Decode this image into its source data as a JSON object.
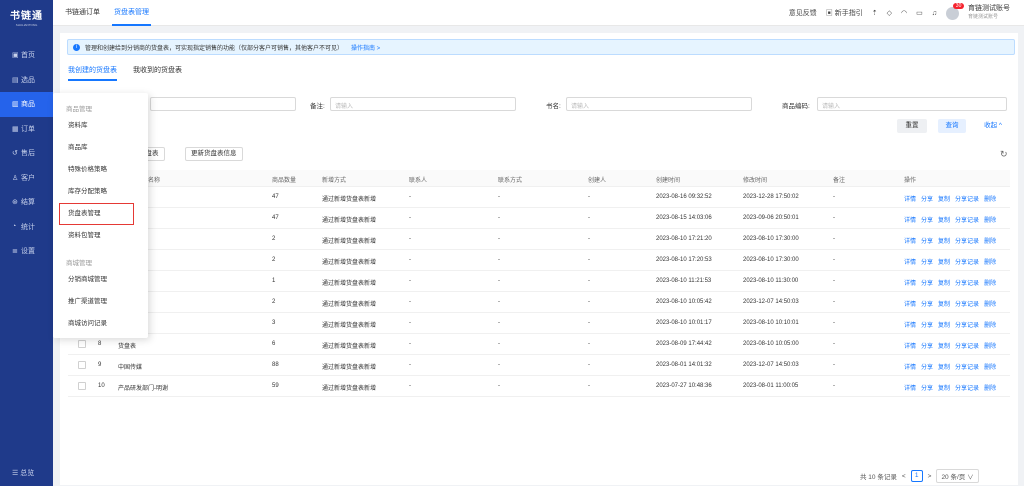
{
  "app": {
    "logo": "书链通",
    "logo_sub": "SHULIANTONG"
  },
  "sidebar": {
    "items": [
      {
        "icon": "dashboard-icon",
        "glyph": "▣",
        "label": "首页"
      },
      {
        "icon": "product-select-icon",
        "glyph": "▤",
        "label": "选品"
      },
      {
        "icon": "goods-icon",
        "glyph": "▥",
        "label": "商品",
        "active": true
      },
      {
        "icon": "order-icon",
        "glyph": "▦",
        "label": "订单"
      },
      {
        "icon": "after-sale-icon",
        "glyph": "↺",
        "label": "售后"
      },
      {
        "icon": "customer-icon",
        "glyph": "♙",
        "label": "客户"
      },
      {
        "icon": "settlement-icon",
        "glyph": "⊛",
        "label": "结算"
      },
      {
        "icon": "stats-icon",
        "glyph": "◔",
        "label": "统计"
      },
      {
        "icon": "settings-icon",
        "glyph": "≣",
        "label": "设置"
      }
    ],
    "bottom": "☰ 总览"
  },
  "topbar": {
    "tabs": [
      "书链通订单",
      "货盘表管理"
    ],
    "feedback": "意见反馈",
    "guide": "新手指引",
    "badge": "30",
    "user_name": "育链测试账号",
    "user_sub": "育链测试账号"
  },
  "notice": {
    "text": "管理和创建给到分销商的货盘表，可实现指定销售的功能（仅部分客户可销售，其他客户不可见）",
    "link": "操作指南 >"
  },
  "subtabs": [
    "我创建的货盘表",
    "我收到的货盘表"
  ],
  "filters": [
    {
      "label": "备注:",
      "placeholder": "请输入"
    },
    {
      "label": "书名:",
      "placeholder": "请输入"
    },
    {
      "label": "商品编码:",
      "placeholder": "请输入"
    }
  ],
  "buttons": {
    "reset": "重置",
    "query": "查询",
    "collapse": "收起 ^",
    "create": "创建货盘表",
    "update": "更新货盘表信息"
  },
  "table": {
    "headers": [
      "名称",
      "商品数量",
      "新增方式",
      "联系人",
      "联系方式",
      "创建人",
      "创建时间",
      "修改时间",
      "备注",
      "操作"
    ],
    "ops": [
      "详情",
      "分享",
      "复制",
      "分享记录",
      "删除"
    ],
    "rows": [
      {
        "idx": "",
        "name": "",
        "qty": "47",
        "method": "通过新增货盘表新增",
        "contact": "-",
        "phone": "-",
        "creator": "-",
        "created": "2023-08-16 09:32:52",
        "modified": "2023-12-28 17:50:02",
        "remark": "-"
      },
      {
        "idx": "",
        "name": "24",
        "qty": "47",
        "method": "通过新增货盘表新增",
        "contact": "-",
        "phone": "-",
        "creator": "-",
        "created": "2023-08-15 14:03:06",
        "modified": "2023-09-06 20:50:01",
        "remark": "-"
      },
      {
        "idx": "",
        "name": "",
        "qty": "2",
        "method": "通过新增货盘表新增",
        "contact": "-",
        "phone": "-",
        "creator": "-",
        "created": "2023-08-10 17:21:20",
        "modified": "2023-08-10 17:30:00",
        "remark": "-"
      },
      {
        "idx": "",
        "name": "",
        "qty": "2",
        "method": "通过新增货盘表新增",
        "contact": "-",
        "phone": "-",
        "creator": "-",
        "created": "2023-08-10 17:20:53",
        "modified": "2023-08-10 17:30:00",
        "remark": "-"
      },
      {
        "idx": "",
        "name": "部门-明谢",
        "qty": "1",
        "method": "通过新增货盘表新增",
        "contact": "-",
        "phone": "-",
        "creator": "-",
        "created": "2023-08-10 11:21:53",
        "modified": "2023-08-10 11:30:00",
        "remark": "-"
      },
      {
        "idx": "",
        "name": "",
        "qty": "2",
        "method": "通过新增货盘表新增",
        "contact": "-",
        "phone": "-",
        "creator": "-",
        "created": "2023-08-10 10:05:42",
        "modified": "2023-12-07 14:50:03",
        "remark": "-"
      },
      {
        "idx": "",
        "name": "部门-明谢2",
        "qty": "3",
        "method": "通过新增货盘表新增",
        "contact": "-",
        "phone": "-",
        "creator": "-",
        "created": "2023-08-10 10:01:17",
        "modified": "2023-08-10 10:10:01",
        "remark": "-"
      },
      {
        "idx": "8",
        "name": "货盘表",
        "qty": "6",
        "method": "通过新增货盘表新增",
        "contact": "-",
        "phone": "-",
        "creator": "-",
        "created": "2023-08-09 17:44:42",
        "modified": "2023-08-10 10:05:00",
        "remark": "-"
      },
      {
        "idx": "9",
        "name": "中国传媒",
        "qty": "88",
        "method": "通过新增货盘表新增",
        "contact": "-",
        "phone": "-",
        "creator": "-",
        "created": "2023-08-01 14:01:32",
        "modified": "2023-12-07 14:50:03",
        "remark": "-"
      },
      {
        "idx": "10",
        "name": "产品研发部门-明谢",
        "qty": "59",
        "method": "通过新增货盘表新增",
        "contact": "-",
        "phone": "-",
        "creator": "-",
        "created": "2023-07-27 10:48:36",
        "modified": "2023-08-01 11:00:05",
        "remark": "-"
      }
    ]
  },
  "pagination": {
    "total": "共 10 条记录",
    "prev": "<",
    "page": "1",
    "next": ">",
    "size": "20 条/页 ∨"
  },
  "submenu": {
    "group1": "商品管理",
    "items1": [
      "资料库",
      "商品库",
      "特殊价格策略",
      "库存分配策略",
      "货盘表管理",
      "资料包管理"
    ],
    "group2": "商城管理",
    "items2": [
      "分销商城管理",
      "推广渠道管理",
      "商城访问记录"
    ]
  }
}
